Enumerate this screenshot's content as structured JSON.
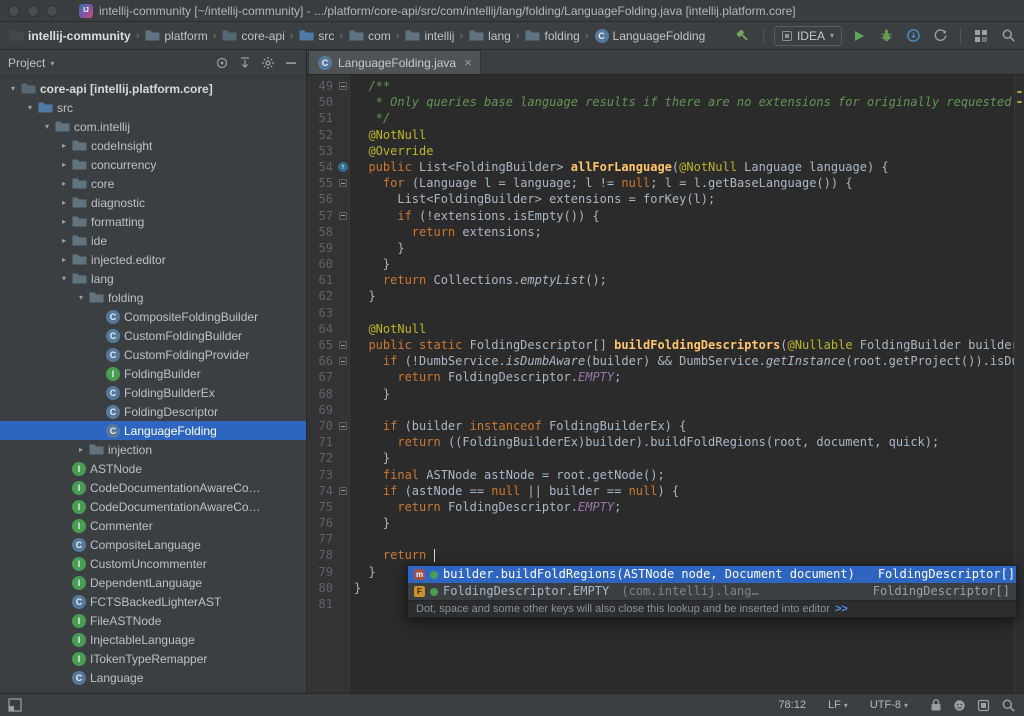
{
  "colors": {
    "chrome": "#3c3f41",
    "editor_bg": "#2b2b2b",
    "gutter_bg": "#313335",
    "sel": "#2d65c0",
    "code": "#a9b7c6",
    "ui": "#bbbbbb",
    "kw": "#cc7832",
    "doc": "#629755",
    "ann": "#bbb529",
    "mth": "#ffc66b",
    "cst": "#9876aa",
    "lnum": "#606366",
    "link": "#5394ec",
    "itf": "#499C54",
    "cls": "#56789a"
  },
  "title_bar": {
    "title": "intellij-community [~/intellij-community] - .../platform/core-api/src/com/intellij/lang/folding/LanguageFolding.java [intellij.platform.core]"
  },
  "nav_bar": {
    "breadcrumbs": [
      {
        "label": "intellij-community",
        "icon": "project",
        "bold": true
      },
      {
        "label": "platform",
        "icon": "folder"
      },
      {
        "label": "core-api",
        "icon": "module"
      },
      {
        "label": "src",
        "icon": "src-folder"
      },
      {
        "label": "com",
        "icon": "folder"
      },
      {
        "label": "intellij",
        "icon": "folder"
      },
      {
        "label": "lang",
        "icon": "folder"
      },
      {
        "label": "folding",
        "icon": "folder"
      },
      {
        "label": "LanguageFolding",
        "icon": "class"
      }
    ],
    "run_config_label": "IDEA"
  },
  "project_panel": {
    "title": "Project",
    "tree": [
      {
        "label": "core-api [intellij.platform.core]",
        "level": 0,
        "icon": "module",
        "state": "expanded",
        "bold": true
      },
      {
        "label": "src",
        "level": 1,
        "icon": "src-folder",
        "state": "expanded"
      },
      {
        "label": "com.intellij",
        "level": 2,
        "icon": "package",
        "state": "expanded"
      },
      {
        "label": "codeInsight",
        "level": 3,
        "icon": "package",
        "state": "collapsed"
      },
      {
        "label": "concurrency",
        "level": 3,
        "icon": "package",
        "state": "collapsed"
      },
      {
        "label": "core",
        "level": 3,
        "icon": "package",
        "state": "collapsed"
      },
      {
        "label": "diagnostic",
        "level": 3,
        "icon": "package",
        "state": "collapsed"
      },
      {
        "label": "formatting",
        "level": 3,
        "icon": "package",
        "state": "collapsed"
      },
      {
        "label": "ide",
        "level": 3,
        "icon": "package",
        "state": "collapsed"
      },
      {
        "label": "injected.editor",
        "level": 3,
        "icon": "package",
        "state": "collapsed"
      },
      {
        "label": "lang",
        "level": 3,
        "icon": "package",
        "state": "expanded"
      },
      {
        "label": "folding",
        "level": 4,
        "icon": "package",
        "state": "expanded"
      },
      {
        "label": "CompositeFoldingBuilder",
        "level": 5,
        "icon": "class",
        "state": "leaf"
      },
      {
        "label": "CustomFoldingBuilder",
        "level": 5,
        "icon": "class",
        "state": "leaf"
      },
      {
        "label": "CustomFoldingProvider",
        "level": 5,
        "icon": "class",
        "state": "leaf"
      },
      {
        "label": "FoldingBuilder",
        "level": 5,
        "icon": "interface",
        "state": "leaf"
      },
      {
        "label": "FoldingBuilderEx",
        "level": 5,
        "icon": "class",
        "state": "leaf"
      },
      {
        "label": "FoldingDescriptor",
        "level": 5,
        "icon": "class",
        "state": "leaf"
      },
      {
        "label": "LanguageFolding",
        "level": 5,
        "icon": "class",
        "state": "leaf",
        "selected": true
      },
      {
        "label": "injection",
        "level": 4,
        "icon": "package",
        "state": "collapsed"
      },
      {
        "label": "ASTNode",
        "level": 3,
        "icon": "interface",
        "state": "leaf"
      },
      {
        "label": "CodeDocumentationAwareCo…",
        "level": 3,
        "icon": "interface",
        "state": "leaf"
      },
      {
        "label": "CodeDocumentationAwareCo…",
        "level": 3,
        "icon": "interface",
        "state": "leaf"
      },
      {
        "label": "Commenter",
        "level": 3,
        "icon": "interface",
        "state": "leaf"
      },
      {
        "label": "CompositeLanguage",
        "level": 3,
        "icon": "class",
        "state": "leaf"
      },
      {
        "label": "CustomUncommenter",
        "level": 3,
        "icon": "interface",
        "state": "leaf"
      },
      {
        "label": "DependentLanguage",
        "level": 3,
        "icon": "interface",
        "state": "leaf"
      },
      {
        "label": "FCTSBackedLighterAST",
        "level": 3,
        "icon": "class",
        "state": "leaf"
      },
      {
        "label": "FileASTNode",
        "level": 3,
        "icon": "interface",
        "state": "leaf"
      },
      {
        "label": "InjectableLanguage",
        "level": 3,
        "icon": "interface",
        "state": "leaf"
      },
      {
        "label": "ITokenTypeRemapper",
        "level": 3,
        "icon": "interface",
        "state": "leaf"
      },
      {
        "label": "Language",
        "level": 3,
        "icon": "class",
        "state": "leaf"
      }
    ]
  },
  "editor": {
    "tab_label": "LanguageFolding.java",
    "lines": [
      {
        "n": 49,
        "fold": true,
        "s": [
          [
            "  /**",
            "doc"
          ]
        ]
      },
      {
        "n": 50,
        "s": [
          [
            "   * Only queries base language results if there are no extensions for originally requested",
            "doc"
          ]
        ]
      },
      {
        "n": 51,
        "s": [
          [
            "   */",
            "doc"
          ]
        ]
      },
      {
        "n": 52,
        "s": [
          [
            "  ",
            "d"
          ],
          [
            "@NotNull",
            "ann"
          ]
        ]
      },
      {
        "n": 53,
        "s": [
          [
            "  ",
            "d"
          ],
          [
            "@Override",
            "ann"
          ]
        ]
      },
      {
        "n": 54,
        "override": true,
        "s": [
          [
            "  ",
            "d"
          ],
          [
            "public ",
            "k"
          ],
          [
            "List<FoldingBuilder> ",
            "d"
          ],
          [
            "allForLanguage",
            "m"
          ],
          [
            "(",
            "d"
          ],
          [
            "@NotNull",
            "ann"
          ],
          [
            " Language language) {",
            "d"
          ]
        ]
      },
      {
        "n": 55,
        "fold": true,
        "s": [
          [
            "    ",
            "d"
          ],
          [
            "for",
            "k"
          ],
          [
            " (Language l = language; l != ",
            "d"
          ],
          [
            "null",
            "k"
          ],
          [
            "; l = l.getBaseLanguage()) {",
            "d"
          ]
        ]
      },
      {
        "n": 56,
        "s": [
          [
            "      List<FoldingBuilder> extensions = forKey(l);",
            "d"
          ]
        ]
      },
      {
        "n": 57,
        "fold": true,
        "s": [
          [
            "      ",
            "d"
          ],
          [
            "if",
            "k"
          ],
          [
            " (!extensions.isEmpty()) {",
            "d"
          ]
        ]
      },
      {
        "n": 58,
        "s": [
          [
            "        ",
            "d"
          ],
          [
            "return",
            "k"
          ],
          [
            " extensions;",
            "d"
          ]
        ]
      },
      {
        "n": 59,
        "s": [
          [
            "      }",
            "d"
          ]
        ]
      },
      {
        "n": 60,
        "s": [
          [
            "    }",
            "d"
          ]
        ]
      },
      {
        "n": 61,
        "s": [
          [
            "    ",
            "d"
          ],
          [
            "return",
            "k"
          ],
          [
            " Collections.",
            "d"
          ],
          [
            "emptyList",
            "si"
          ],
          [
            "();",
            "d"
          ]
        ]
      },
      {
        "n": 62,
        "s": [
          [
            "  }",
            "d"
          ]
        ]
      },
      {
        "n": 63,
        "s": []
      },
      {
        "n": 64,
        "s": [
          [
            "  ",
            "d"
          ],
          [
            "@NotNull",
            "ann"
          ]
        ]
      },
      {
        "n": 65,
        "fold": true,
        "s": [
          [
            "  ",
            "d"
          ],
          [
            "public static ",
            "k"
          ],
          [
            "FoldingDescriptor[] ",
            "d"
          ],
          [
            "buildFoldingDescriptors",
            "m"
          ],
          [
            "(",
            "d"
          ],
          [
            "@Nullable",
            "ann"
          ],
          [
            " FoldingBuilder builder",
            "d"
          ]
        ]
      },
      {
        "n": 66,
        "fold": true,
        "s": [
          [
            "    ",
            "d"
          ],
          [
            "if",
            "k"
          ],
          [
            " (!DumbService.",
            "d"
          ],
          [
            "isDumbAware",
            "si"
          ],
          [
            "(builder) && DumbService.",
            "d"
          ],
          [
            "getInstance",
            "si"
          ],
          [
            "(root.getProject()).isDu",
            "d"
          ]
        ]
      },
      {
        "n": 67,
        "s": [
          [
            "      ",
            "d"
          ],
          [
            "return",
            "k"
          ],
          [
            " FoldingDescriptor.",
            "d"
          ],
          [
            "EMPTY",
            "c"
          ],
          [
            ";",
            "d"
          ]
        ]
      },
      {
        "n": 68,
        "s": [
          [
            "    }",
            "d"
          ]
        ]
      },
      {
        "n": 69,
        "s": []
      },
      {
        "n": 70,
        "fold": true,
        "s": [
          [
            "    ",
            "d"
          ],
          [
            "if",
            "k"
          ],
          [
            " (builder ",
            "d"
          ],
          [
            "instanceof",
            "k"
          ],
          [
            " FoldingBuilderEx) {",
            "d"
          ]
        ]
      },
      {
        "n": 71,
        "s": [
          [
            "      ",
            "d"
          ],
          [
            "return",
            "k"
          ],
          [
            " ((FoldingBuilderEx)builder).buildFoldRegions(root, document, quick);",
            "d"
          ]
        ]
      },
      {
        "n": 72,
        "s": [
          [
            "    }",
            "d"
          ]
        ]
      },
      {
        "n": 73,
        "s": [
          [
            "    ",
            "d"
          ],
          [
            "final",
            "k"
          ],
          [
            " ASTNode astNode = root.getNode();",
            "d"
          ]
        ]
      },
      {
        "n": 74,
        "fold": true,
        "s": [
          [
            "    ",
            "d"
          ],
          [
            "if",
            "k"
          ],
          [
            " (astNode == ",
            "d"
          ],
          [
            "null",
            "k"
          ],
          [
            " || builder == ",
            "d"
          ],
          [
            "null",
            "k"
          ],
          [
            ") {",
            "d"
          ]
        ]
      },
      {
        "n": 75,
        "s": [
          [
            "      ",
            "d"
          ],
          [
            "return",
            "k"
          ],
          [
            " FoldingDescriptor.",
            "d"
          ],
          [
            "EMPTY",
            "c"
          ],
          [
            ";",
            "d"
          ]
        ]
      },
      {
        "n": 76,
        "s": [
          [
            "    }",
            "d"
          ]
        ]
      },
      {
        "n": 77,
        "s": []
      },
      {
        "n": 78,
        "caret": true,
        "s": [
          [
            "    ",
            "d"
          ],
          [
            "return ",
            "k"
          ]
        ]
      },
      {
        "n": 79,
        "s": [
          [
            "  }",
            "d"
          ]
        ]
      },
      {
        "n": 80,
        "s": [
          [
            "}",
            "d"
          ]
        ]
      },
      {
        "n": 81,
        "s": []
      }
    ]
  },
  "completion": {
    "items": [
      {
        "name": "builder.buildFoldRegions(ASTNode node, Document document)",
        "tail": "",
        "type": "FoldingDescriptor[]",
        "kind": "method",
        "selected": true
      },
      {
        "name": "FoldingDescriptor.EMPTY",
        "tail": " (com.intellij.lang…",
        "type": "FoldingDescriptor[]",
        "kind": "field",
        "selected": false
      }
    ],
    "hint": "Dot, space and some other keys will also close this lookup and be inserted into editor",
    "hint_link": ">>"
  },
  "status_bar": {
    "caret_position": "78:12",
    "line_separator": "LF",
    "encoding": "UTF-8"
  }
}
